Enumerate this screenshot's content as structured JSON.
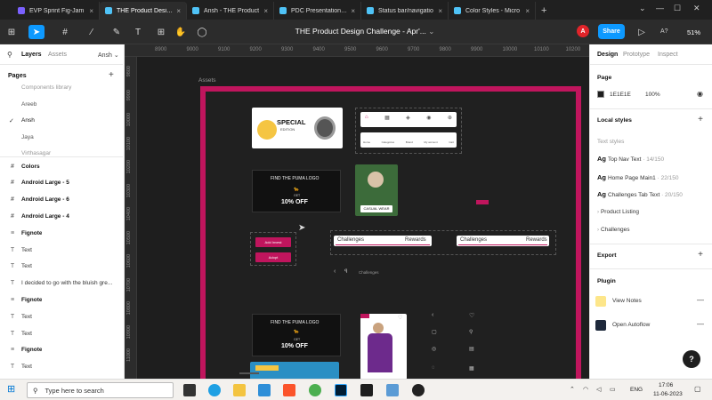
{
  "browser": {
    "tabs": [
      {
        "title": "EVP Sprint Fig-Jam",
        "color": "#7b61ff"
      },
      {
        "title": "THE Product Design",
        "color": "#4fc3f7"
      },
      {
        "title": "Ansh - THE Product",
        "color": "#4fc3f7"
      },
      {
        "title": "PDC Presentation Ex",
        "color": "#4fc3f7"
      },
      {
        "title": "Status bar/navigatio",
        "color": "#4fc3f7"
      },
      {
        "title": "Color Styles - Micro",
        "color": "#4fc3f7"
      }
    ],
    "new_tab": "+"
  },
  "toolbar": {
    "doc_title": "THE Product Design Challenge - Apr'...",
    "avatar_letter": "A",
    "share_label": "Share",
    "zoom": "51%",
    "a_label": "A?"
  },
  "left_panel": {
    "tabs": [
      "Layers",
      "Assets"
    ],
    "page_owner": "Ansh",
    "pages_label": "Pages",
    "pages": [
      "Components library",
      "Areeb",
      "Ansh",
      "Jaya",
      "Virthasagar"
    ],
    "layers": [
      {
        "name": "Colors",
        "icon": "#",
        "bold": true
      },
      {
        "name": "Android Large - 5",
        "icon": "#",
        "bold": true
      },
      {
        "name": "Android Large - 6",
        "icon": "#",
        "bold": true
      },
      {
        "name": "Android Large - 4",
        "icon": "#",
        "bold": true
      },
      {
        "name": "Fignote",
        "icon": "≡",
        "bold": true
      },
      {
        "name": "Text",
        "icon": "T",
        "bold": false
      },
      {
        "name": "Text",
        "icon": "T",
        "bold": false
      },
      {
        "name": "I decided to go with the bluish gre...",
        "icon": "T",
        "bold": false
      },
      {
        "name": "Fignote",
        "icon": "≡",
        "bold": true
      },
      {
        "name": "Text",
        "icon": "T",
        "bold": false
      },
      {
        "name": "Text",
        "icon": "T",
        "bold": false
      },
      {
        "name": "Fignote",
        "icon": "≡",
        "bold": true
      },
      {
        "name": "Text",
        "icon": "T",
        "bold": false
      }
    ]
  },
  "right_panel": {
    "tabs": [
      "Design",
      "Prototype",
      "Inspect"
    ],
    "page_label": "Page",
    "page_color_hex": "1E1E1E",
    "page_opacity": "100%",
    "local_styles": "Local styles",
    "text_styles_label": "Text styles",
    "text_styles": [
      {
        "name": "Top Nav Text",
        "meta": " · 14/150"
      },
      {
        "name": "Home Page Main1",
        "meta": " · 22/150"
      },
      {
        "name": "Challenges Tab Text",
        "meta": " · 20/150"
      }
    ],
    "groups": [
      "Product Listing",
      "Challenges"
    ],
    "export_label": "Export",
    "plugin_label": "Plugin",
    "plugins": [
      "View Notes",
      "Open Autoflow"
    ],
    "help": "?"
  },
  "rulers": {
    "top": [
      "8900",
      "9000",
      "9100",
      "9200",
      "9300",
      "9400",
      "9500",
      "9600",
      "9700",
      "9800",
      "9900",
      "10000",
      "10100",
      "10200",
      "10300"
    ],
    "left": [
      "9800",
      "9900",
      "10000",
      "10100",
      "10200",
      "10300",
      "10400",
      "10500",
      "10600",
      "10700",
      "10800",
      "10900",
      "11000"
    ]
  },
  "canvas": {
    "assets_label": "Assets",
    "special_title": "SPECIAL",
    "special_sub": "EDITION",
    "puma_title": "FIND THE PUMA LOGO",
    "puma_get": "GET",
    "puma_off": "10% OFF",
    "casual_wear": "CASUAL WEAR",
    "add_invest": "Add Invest",
    "adopt": "Adopt",
    "challenges": "Challenges",
    "rewards": "Rewards",
    "challenges_small": "Challenges",
    "nav_items": [
      "Home",
      "Categories",
      "Brand",
      "My account",
      "Cart"
    ]
  },
  "taskbar": {
    "search_placeholder": "Type here to search",
    "lang": "ENG",
    "time": "17:06",
    "date": "11-06-2023"
  },
  "colors": {
    "figma_blue": "#0d99ff",
    "frame_pink": "#c0155d",
    "canvas_bg": "#1e1e1e"
  }
}
